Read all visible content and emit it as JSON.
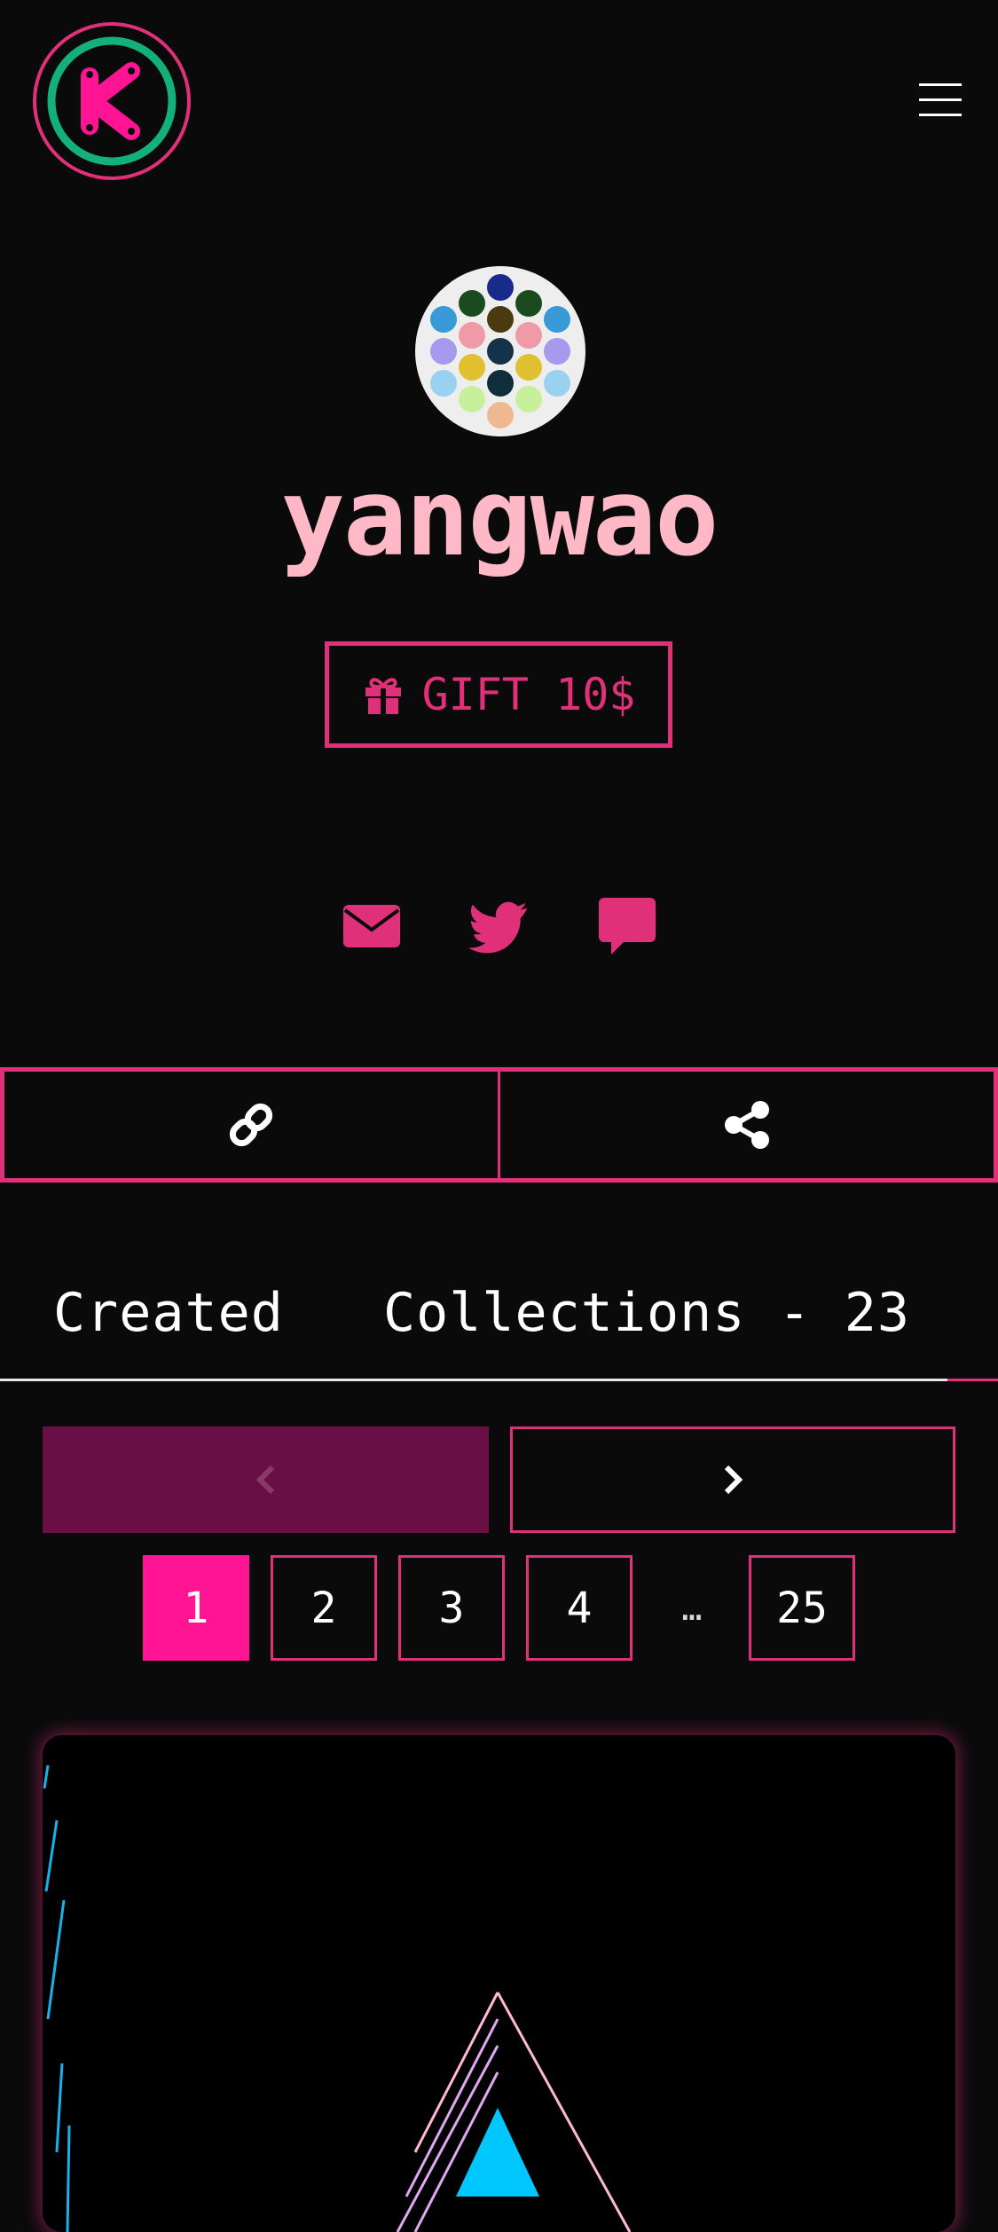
{
  "header": {
    "logo_icon": "k-logo-icon",
    "menu_icon": "hamburger-menu-icon"
  },
  "profile": {
    "username": "yangwao",
    "avatar_icon": "dot-pattern-avatar",
    "gift_button": "GIFT 10$",
    "gift_icon": "gift-icon",
    "social_icons": [
      "email-icon",
      "twitter-icon",
      "comment-icon"
    ]
  },
  "actions": {
    "copy_link_icon": "link-icon",
    "share_icon": "share-icon"
  },
  "tabs": {
    "created": "Created",
    "collections": "Collections - 23"
  },
  "pagination": {
    "prev_icon": "chevron-left-icon",
    "next_icon": "chevron-right-icon",
    "pages": [
      "1",
      "2",
      "3",
      "4",
      "25"
    ],
    "ellipsis": "…",
    "current": "1"
  },
  "colors": {
    "accent": "#e0307a",
    "accent_bright": "#ff1493",
    "username": "#ffb8c6",
    "logo_ring_inner": "#13b07a",
    "prev_disabled": "#6a0f45",
    "background": "#0a0a0b"
  }
}
